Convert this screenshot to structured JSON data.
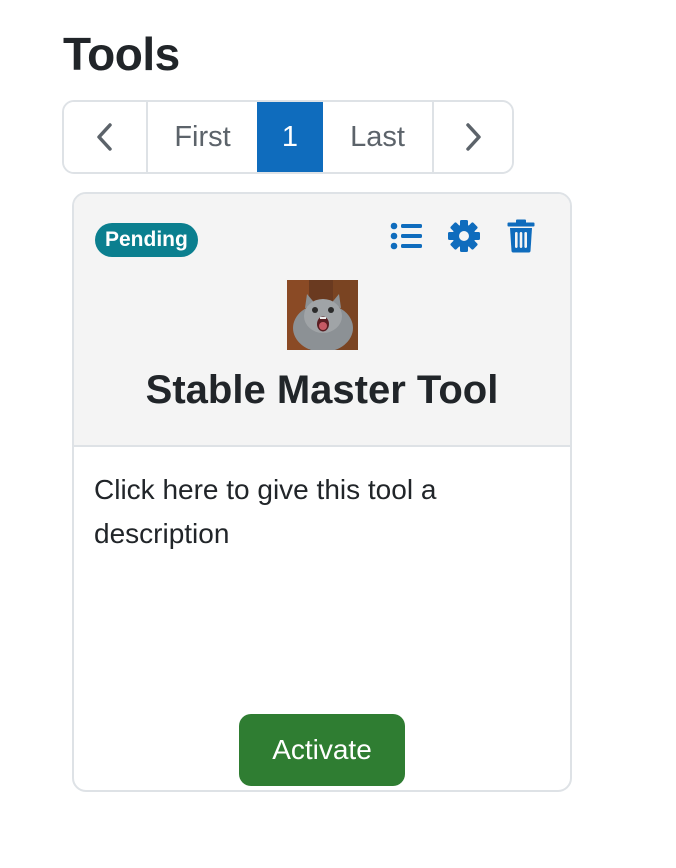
{
  "page": {
    "title": "Tools"
  },
  "pagination": {
    "prev_icon": "chevron-left-icon",
    "first_label": "First",
    "current_page": "1",
    "last_label": "Last",
    "next_icon": "chevron-right-icon"
  },
  "card": {
    "status_badge": "Pending",
    "icons": [
      "list-icon",
      "gear-icon",
      "trash-icon"
    ],
    "image": "cat-thumbnail",
    "title": "Stable Master Tool",
    "description": "Click here to give this tool a description",
    "activate_label": "Activate"
  },
  "colors": {
    "accent_blue": "#0f6cbd",
    "badge_teal": "#0b7f8f",
    "activate_green": "#2f7d32",
    "header_bg": "#f4f4f4",
    "border": "#dee2e6"
  }
}
